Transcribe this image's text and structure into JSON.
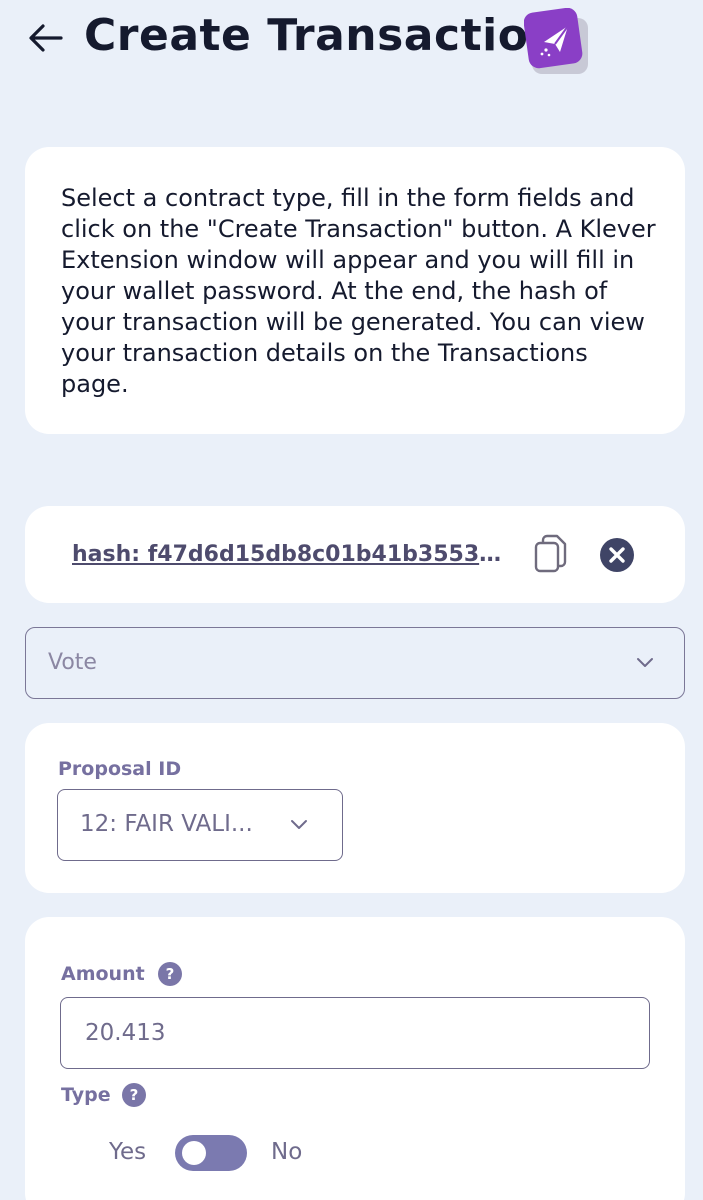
{
  "header": {
    "title": "Create Transaction",
    "back_icon": "arrow-left-icon",
    "title_icon": "paper-plane-icon",
    "accent_color": "#8a3fc6"
  },
  "info": {
    "text": "Select a contract type, fill in the form fields and click on the \"Create Transaction\" button. A Klever Extension window will appear and you will fill in your wallet password. At the end, the hash of your transaction will be generated. You can view your transaction details on the Transactions page."
  },
  "hash": {
    "text": "hash: f47d6d15db8c01b41b3553f0...",
    "copy_icon": "copy-icon",
    "clear_icon": "close-circle-icon"
  },
  "contract": {
    "selected": "Vote",
    "chevron_icon": "chevron-down-icon"
  },
  "proposal": {
    "label": "Proposal ID",
    "selected": "12: FAIR VALI..."
  },
  "amount": {
    "label": "Amount",
    "value": "20.413",
    "help": "?"
  },
  "type": {
    "label": "Type",
    "help": "?",
    "yes_label": "Yes",
    "no_label": "No"
  }
}
